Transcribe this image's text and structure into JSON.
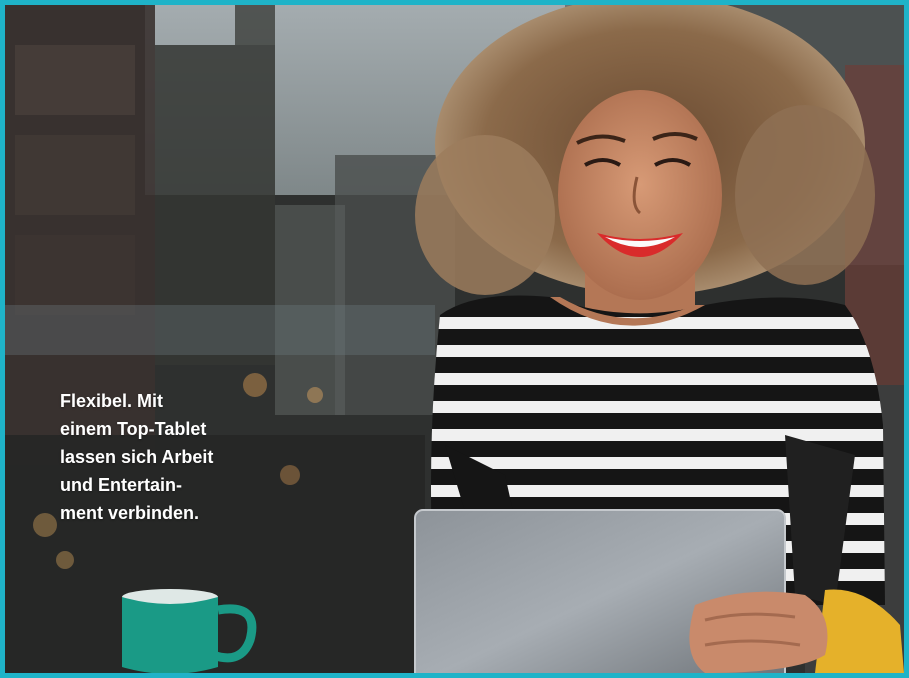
{
  "photo": {
    "subject": "Smiling woman with curly hair in a striped shirt holding a tablet behind a café window, with a green mug on the table",
    "frame_color": "#1fb3c8",
    "mug_color": "#1a9a86",
    "shirt_colors": [
      "#1a1a1a",
      "#f2f2f2"
    ],
    "lip_color": "#d92b2b"
  },
  "caption": {
    "lines": [
      "Flexibel. Mit",
      "einem Top-Tablet",
      "lassen sich Arbeit",
      "und Entertain-",
      "ment verbinden."
    ]
  }
}
